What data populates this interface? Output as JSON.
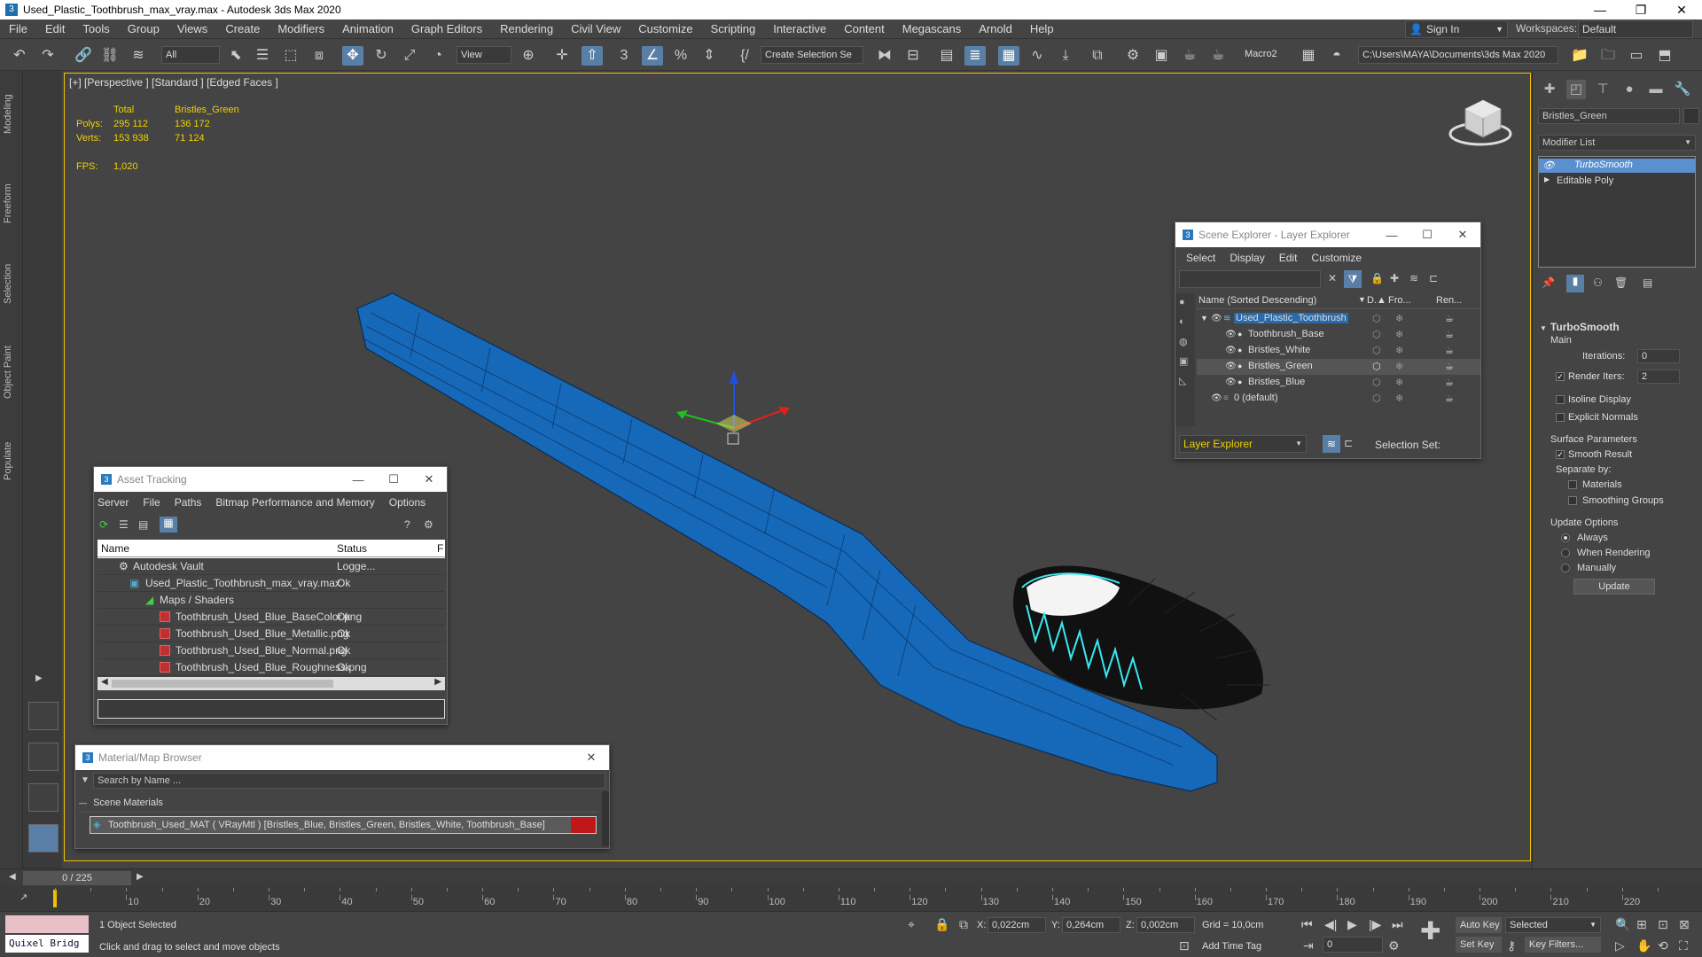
{
  "window": {
    "title": "Used_Plastic_Toothbrush_max_vray.max - Autodesk 3ds Max 2020",
    "app_icon": "3",
    "controls": [
      "—",
      "❐",
      "✕"
    ]
  },
  "menubar": {
    "items": [
      "File",
      "Edit",
      "Tools",
      "Group",
      "Views",
      "Create",
      "Modifiers",
      "Animation",
      "Graph Editors",
      "Rendering",
      "Civil View",
      "Customize",
      "Scripting",
      "Interactive",
      "Content",
      "Megascans",
      "Arnold",
      "Help"
    ],
    "sign_in": "Sign In",
    "workspaces_label": "Workspaces:",
    "workspace_value": "Default"
  },
  "toolbar": {
    "selection_filter": "All",
    "reference_coord": "View",
    "named_selection": "Create Selection Se",
    "macro": "Macro2",
    "project_path": "C:\\Users\\MAYA\\Documents\\3ds Max 2020"
  },
  "left_tabs": [
    "Modeling",
    "Freeform",
    "Selection",
    "Object Paint",
    "Populate"
  ],
  "viewport": {
    "label": "[+] [Perspective ] [Standard ] [Edged Faces ]",
    "stats": {
      "col_total": "Total",
      "col_object": "Bristles_Green",
      "polys_label": "Polys:",
      "polys_total": "295 112",
      "polys_object": "136 172",
      "verts_label": "Verts:",
      "verts_total": "153 938",
      "verts_object": "71 124",
      "fps_label": "FPS:",
      "fps_value": "1,020"
    }
  },
  "scene_explorer": {
    "title": "Scene Explorer - Layer Explorer",
    "menu": [
      "Select",
      "Display",
      "Edit",
      "Customize"
    ],
    "columns": [
      "Name (Sorted Descending)",
      "D.▲",
      "Fro...",
      "Ren..."
    ],
    "rows": [
      {
        "name": "Used_Plastic_Toothbrush",
        "level": 0,
        "selected": false,
        "highlight": true
      },
      {
        "name": "Toothbrush_Base",
        "level": 1,
        "selected": false,
        "highlight": false
      },
      {
        "name": "Bristles_White",
        "level": 1,
        "selected": false,
        "highlight": false
      },
      {
        "name": "Bristles_Green",
        "level": 1,
        "selected": true,
        "highlight": false
      },
      {
        "name": "Bristles_Blue",
        "level": 1,
        "selected": false,
        "highlight": false
      },
      {
        "name": "0 (default)",
        "level": 0,
        "selected": false,
        "highlight": false
      }
    ],
    "footer_dropdown": "Layer Explorer",
    "selection_set_label": "Selection Set:"
  },
  "asset_tracking": {
    "title": "Asset Tracking",
    "menu": [
      "Server",
      "File",
      "Paths",
      "Bitmap Performance and Memory",
      "Options"
    ],
    "columns": [
      "Name",
      "Status",
      "F"
    ],
    "rows": [
      {
        "name": "Autodesk Vault",
        "status": "Logge...",
        "indent": 1,
        "icon": "vault"
      },
      {
        "name": "Used_Plastic_Toothbrush_max_vray.max",
        "status": "Ok",
        "indent": 2,
        "icon": "max"
      },
      {
        "name": "Maps / Shaders",
        "status": "",
        "indent": 3,
        "icon": "maps"
      },
      {
        "name": "Toothbrush_Used_Blue_BaseColor.png",
        "status": "Ok",
        "indent": 4,
        "icon": "png"
      },
      {
        "name": "Toothbrush_Used_Blue_Metallic.png",
        "status": "Ok",
        "indent": 4,
        "icon": "png"
      },
      {
        "name": "Toothbrush_Used_Blue_Normal.png",
        "status": "Ok",
        "indent": 4,
        "icon": "png"
      },
      {
        "name": "Toothbrush_Used_Blue_Roughness.png",
        "status": "Ok",
        "indent": 4,
        "icon": "png"
      }
    ]
  },
  "material_browser": {
    "title": "Material/Map Browser",
    "search_placeholder": "Search by Name ...",
    "section": "Scene Materials",
    "material": "Toothbrush_Used_MAT ( VRayMtl ) [Bristles_Blue, Bristles_Green, Bristles_White, Toothbrush_Base]"
  },
  "command_panel": {
    "object_name": "Bristles_Green",
    "modifier_list": "Modifier List",
    "stack": [
      "TurboSmooth",
      "Editable Poly"
    ],
    "rollout_title": "TurboSmooth",
    "main_label": "Main",
    "iterations_label": "Iterations:",
    "iterations_value": "0",
    "render_iters_label": "Render Iters:",
    "render_iters_value": "2",
    "isoline_label": "Isoline Display",
    "explicit_normals_label": "Explicit Normals",
    "surface_params_label": "Surface Parameters",
    "smooth_result_label": "Smooth Result",
    "separate_by_label": "Separate by:",
    "materials_label": "Materials",
    "smoothing_groups_label": "Smoothing Groups",
    "update_options_label": "Update Options",
    "always_label": "Always",
    "when_rendering_label": "When Rendering",
    "manually_label": "Manually",
    "update_button": "Update"
  },
  "trackbar": {
    "frame": "0 / 225"
  },
  "timeline": {
    "ticks": [
      10,
      20,
      30,
      40,
      50,
      60,
      70,
      80,
      90,
      100,
      110,
      120,
      130,
      140,
      150,
      160,
      170,
      180,
      190,
      200,
      210,
      220
    ]
  },
  "statusbar": {
    "quixel": "Quixel Bridg",
    "selected": "1 Object Selected",
    "prompt": "Click and drag to select and move objects",
    "x_label": "X:",
    "x_value": "0,022cm",
    "y_label": "Y:",
    "y_value": "0,264cm",
    "z_label": "Z:",
    "z_value": "0,002cm",
    "grid": "Grid = 10,0cm",
    "add_time_tag": "Add Time Tag",
    "auto_key": "Auto Key",
    "selected_dropdown": "Selected",
    "set_key": "Set Key",
    "key_filters": "Key Filters...",
    "frame_field": "0"
  },
  "colors": {
    "viewport_border": "#f0c000",
    "stats_text": "#f0d000",
    "toothbrush_blue": "#1668b8",
    "bristles_cyan": "#38e8f0"
  }
}
